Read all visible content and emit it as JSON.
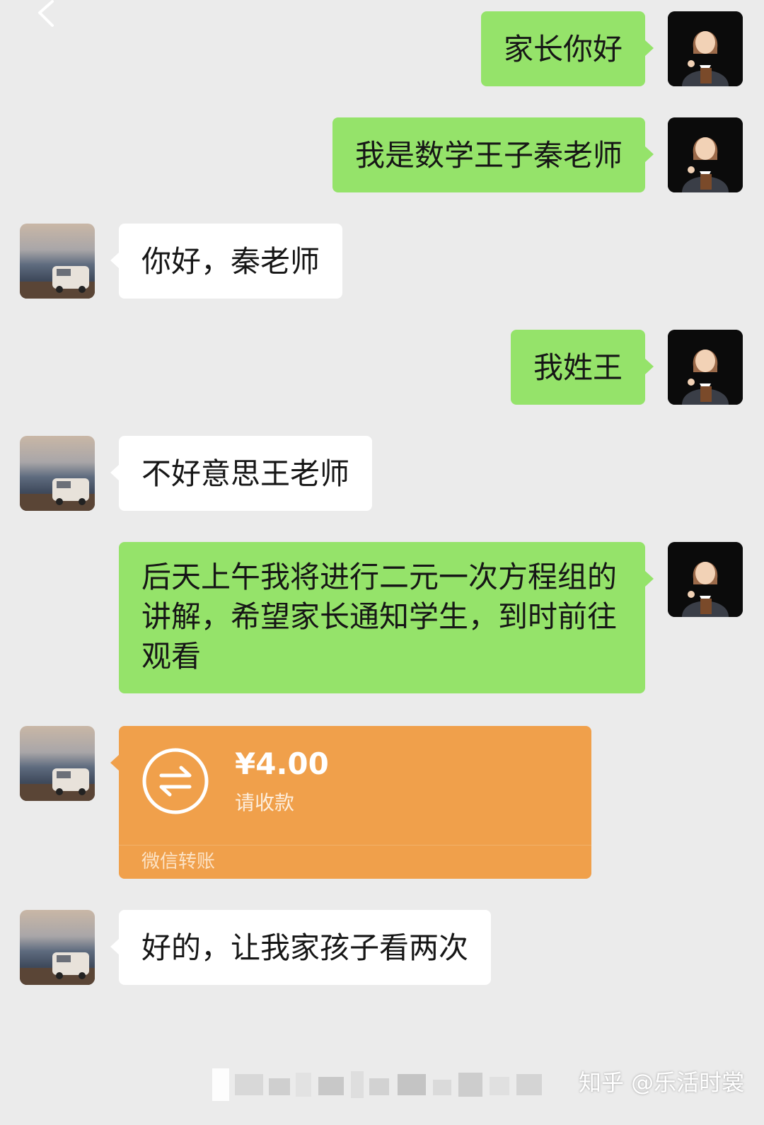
{
  "messages": [
    {
      "text": "家长你好"
    },
    {
      "text": "我是数学王子秦老师"
    },
    {
      "text": "你好，秦老师"
    },
    {
      "text": "我姓王"
    },
    {
      "text": "不好意思王老师"
    },
    {
      "text": "后天上午我将进行二元一次方程组的讲解，希望家长通知学生，到时前往观看"
    },
    {
      "text": "好的，让我家孩子看两次"
    }
  ],
  "transfer": {
    "amount": "¥4.00",
    "status": "请收款",
    "footer": "微信转账"
  },
  "watermark": "知乎 @乐活时裳",
  "colors": {
    "background": "#ebebeb",
    "sent_bubble": "#95e36a",
    "received_bubble": "#ffffff",
    "transfer_card": "#f0a04b"
  },
  "icons": [
    "back-arrow-icon",
    "transfer-arrows-icon"
  ]
}
